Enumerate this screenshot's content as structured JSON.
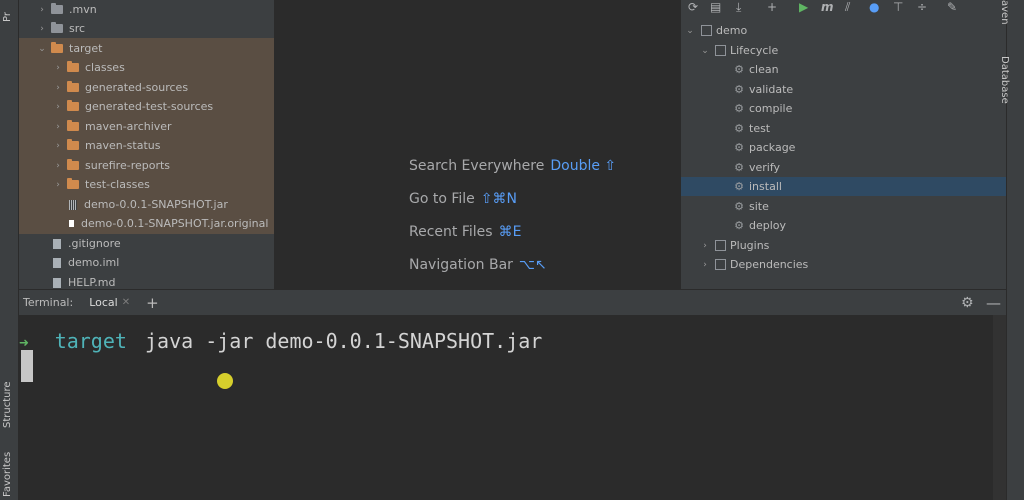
{
  "left_strip": {
    "tabs": [
      "Pr",
      "Structure",
      "Favorites"
    ]
  },
  "right_strip": {
    "tabs": [
      "aven",
      "Database"
    ]
  },
  "project_tree": [
    {
      "label": ".mvn",
      "type": "folder",
      "color": "grey",
      "expanded": false
    },
    {
      "label": "src",
      "type": "folder",
      "color": "grey",
      "expanded": false
    },
    {
      "label": "target",
      "type": "folder",
      "color": "orange",
      "expanded": true
    },
    {
      "label": "classes",
      "type": "folder",
      "color": "orange",
      "expanded": false
    },
    {
      "label": "generated-sources",
      "type": "folder",
      "color": "orange",
      "expanded": false
    },
    {
      "label": "generated-test-sources",
      "type": "folder",
      "color": "orange",
      "expanded": false
    },
    {
      "label": "maven-archiver",
      "type": "folder",
      "color": "orange",
      "expanded": false
    },
    {
      "label": "maven-status",
      "type": "folder",
      "color": "orange",
      "expanded": false
    },
    {
      "label": "surefire-reports",
      "type": "folder",
      "color": "orange",
      "expanded": false
    },
    {
      "label": "test-classes",
      "type": "folder",
      "color": "orange",
      "expanded": false
    },
    {
      "label": "demo-0.0.1-SNAPSHOT.jar",
      "type": "jar"
    },
    {
      "label": "demo-0.0.1-SNAPSHOT.jar.original",
      "type": "file"
    },
    {
      "label": ".gitignore",
      "type": "file"
    },
    {
      "label": "demo.iml",
      "type": "file"
    },
    {
      "label": "HELP.md",
      "type": "file"
    }
  ],
  "editor_hints": [
    {
      "label": "Search Everywhere",
      "shortcut": "Double ⇧"
    },
    {
      "label": "Go to File",
      "shortcut": "⇧⌘N"
    },
    {
      "label": "Recent Files",
      "shortcut": "⌘E"
    },
    {
      "label": "Navigation Bar",
      "shortcut": "⌥↖"
    }
  ],
  "maven": {
    "project": "demo",
    "lifecycle_label": "Lifecycle",
    "phases": [
      "clean",
      "validate",
      "compile",
      "test",
      "package",
      "verify",
      "install",
      "site",
      "deploy"
    ],
    "selected_phase": "install",
    "plugins_label": "Plugins",
    "dependencies_label": "Dependencies",
    "toolbar_icons": [
      "reload-icon",
      "add-maven-project-icon",
      "download-icon",
      "plus-icon",
      "run-icon",
      "maven-goal-icon",
      "toggle-offline-icon",
      "skip-tests-icon",
      "show-dependencies-icon",
      "collapse-all-icon",
      "settings-wrench-icon"
    ]
  },
  "terminal": {
    "title": "Terminal:",
    "tab_label": "Local",
    "prompt_arrow": "➜",
    "directory": "target",
    "command": "java -jar demo-0.0.1-SNAPSHOT.jar"
  },
  "colors": {
    "accent_blue": "#589df6",
    "prompt_green": "#5fb563",
    "directory_teal": "#4fb3b8",
    "folder_orange": "#d08a4d",
    "selection": "#2f4a63"
  }
}
